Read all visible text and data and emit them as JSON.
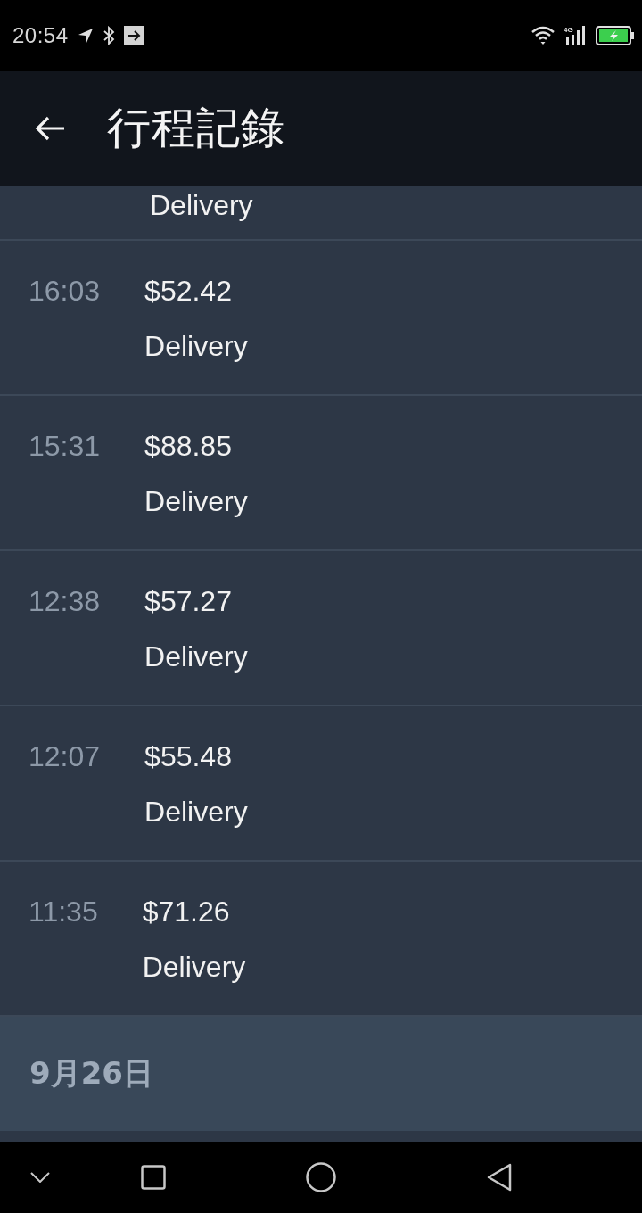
{
  "status_bar": {
    "time": "20:54",
    "network": "4G"
  },
  "app_bar": {
    "title": "行程記錄"
  },
  "trips": [
    {
      "type": "Delivery"
    },
    {
      "time": "16:03",
      "amount": "$52.42",
      "type": "Delivery"
    },
    {
      "time": "15:31",
      "amount": "$88.85",
      "type": "Delivery"
    },
    {
      "time": "12:38",
      "amount": "$57.27",
      "type": "Delivery"
    },
    {
      "time": "12:07",
      "amount": "$55.48",
      "type": "Delivery"
    },
    {
      "time": "11:35",
      "amount": "$71.26",
      "type": "Delivery"
    }
  ],
  "date_header": "9月26日"
}
